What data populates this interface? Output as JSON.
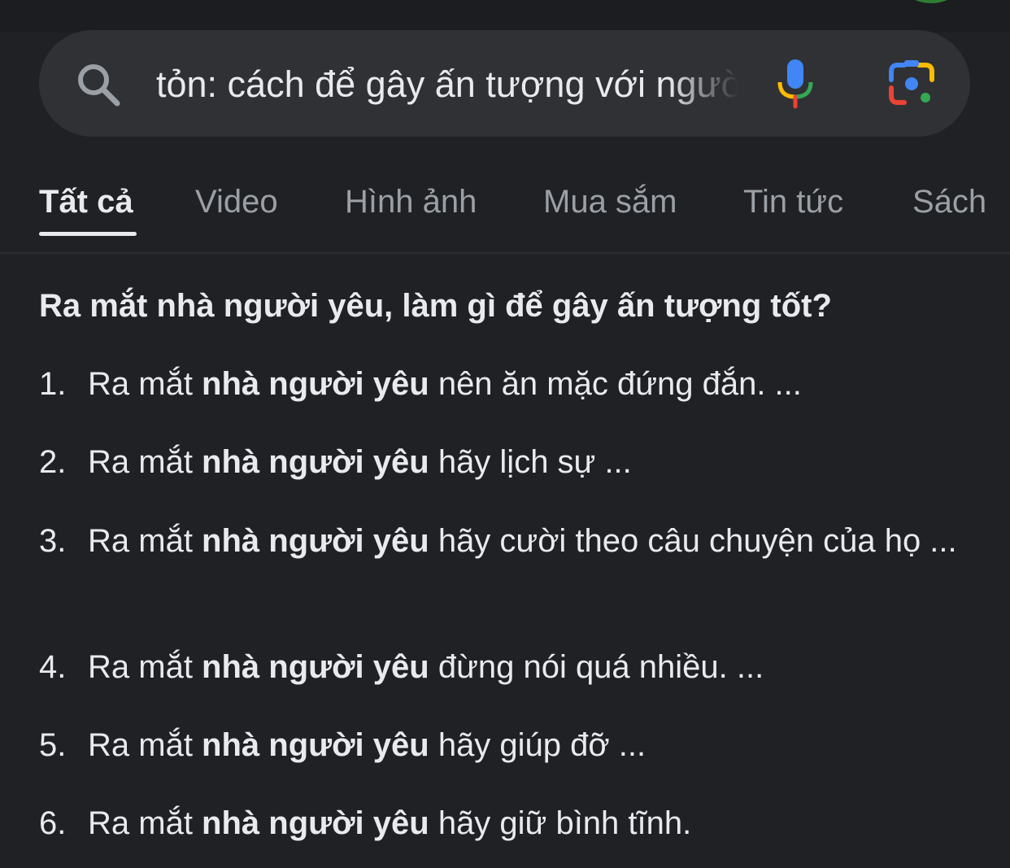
{
  "search": {
    "query": "tỏn: cách để gây ấn tượng với người yêu",
    "colors": {
      "mic_blue": "#4285f4",
      "mic_red": "#ea4335",
      "mic_yellow": "#fbbc05",
      "mic_green": "#34a853"
    }
  },
  "tabs": [
    {
      "label": "Tất cả",
      "active": true
    },
    {
      "label": "Video",
      "active": false
    },
    {
      "label": "Hình ảnh",
      "active": false
    },
    {
      "label": "Mua sắm",
      "active": false
    },
    {
      "label": "Tin tức",
      "active": false
    },
    {
      "label": "Sách",
      "active": false
    }
  ],
  "answer": {
    "heading": "Ra mắt nhà người yêu, làm gì để gây ấn tượng tốt?",
    "items": [
      {
        "num": "1.",
        "lead": "Ra mắt ",
        "bold": "nhà người yêu",
        "rest": " nên ăn mặc đứng đắn. ..."
      },
      {
        "num": "2.",
        "lead": "Ra mắt ",
        "bold": "nhà người yêu",
        "rest": " hãy lịch sự ..."
      },
      {
        "num": "3.",
        "lead": "Ra mắt ",
        "bold": "nhà người yêu",
        "rest": " hãy cười theo câu chuyện của họ ..."
      },
      {
        "num": "4.",
        "lead": "Ra mắt ",
        "bold": "nhà người yêu",
        "rest": " đừng nói quá nhiều. ..."
      },
      {
        "num": "5.",
        "lead": "Ra mắt ",
        "bold": "nhà người yêu",
        "rest": " hãy giúp đỡ ..."
      },
      {
        "num": "6.",
        "lead": "Ra mắt ",
        "bold": "nhà người yêu",
        "rest": " hãy giữ bình tĩnh."
      }
    ]
  }
}
